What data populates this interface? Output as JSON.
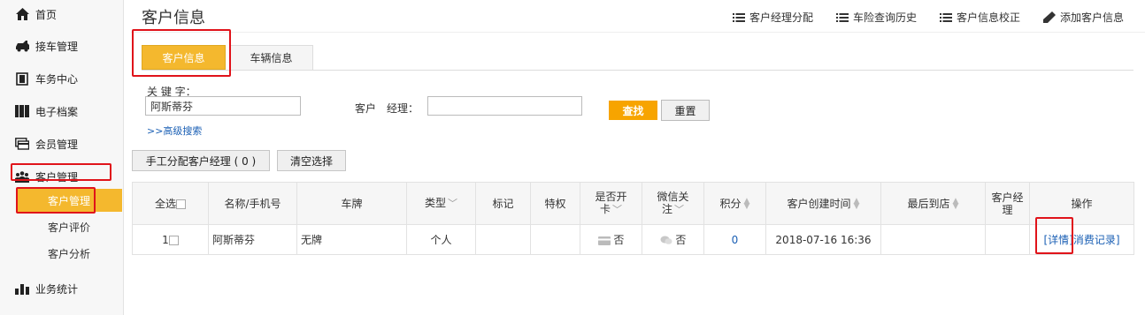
{
  "sidebar": {
    "items": [
      {
        "label": "首页",
        "icon": "home-icon"
      },
      {
        "label": "接车管理",
        "icon": "car-icon"
      },
      {
        "label": "车务中心",
        "icon": "door-icon"
      },
      {
        "label": "电子档案",
        "icon": "archive-icon"
      },
      {
        "label": "会员管理",
        "icon": "card-icon"
      },
      {
        "label": "客户管理",
        "icon": "people-icon"
      },
      {
        "label": "业务统计",
        "icon": "chart-icon"
      }
    ],
    "sub_items": [
      {
        "label": "客户管理",
        "active": true
      },
      {
        "label": "客户评价",
        "active": false
      },
      {
        "label": "客户分析",
        "active": false
      }
    ]
  },
  "header": {
    "title": "客户信息",
    "toolbar": [
      {
        "label": "客户经理分配",
        "icon": "list-icon"
      },
      {
        "label": "车险查询历史",
        "icon": "list-icon"
      },
      {
        "label": "客户信息校正",
        "icon": "list-icon"
      },
      {
        "label": "添加客户信息",
        "icon": "pencil-icon"
      }
    ]
  },
  "tabs": [
    {
      "label": "客户信息",
      "active": true
    },
    {
      "label": "车辆信息",
      "active": false
    }
  ],
  "search": {
    "keyword_label": "关 键 字：",
    "keyword_value": "阿斯蒂芬",
    "manager_label": "客户　经理：",
    "manager_value": "",
    "search_button": "查找",
    "reset_button": "重置",
    "advanced_link": ">>高级搜索"
  },
  "actions": {
    "assign_button": "手工分配客户经理 ( 0 )",
    "clear_button": "清空选择"
  },
  "table": {
    "headers": {
      "select_all": "全选",
      "name_phone": "名称/手机号",
      "plate": "车牌",
      "type": "类型",
      "mark": "标记",
      "privilege": "特权",
      "card_line1": "是否开",
      "card_line2": "卡",
      "wechat_line1": "微信关",
      "wechat_line2": "注",
      "points": "积分",
      "created": "客户创建时间",
      "last_visit": "最后到店",
      "manager_line1": "客户经",
      "manager_line2": "理",
      "ops": "操作"
    },
    "rows": [
      {
        "index": "1",
        "name": "阿斯蒂芬",
        "plate": "无牌",
        "type": "个人",
        "mark": "",
        "privilege": "",
        "card": "否",
        "wechat": "否",
        "points": "0",
        "created": "2018-07-16 16:36",
        "last_visit": "",
        "manager": "",
        "detail_link": "[详情]",
        "consume_link": "消费记录]"
      }
    ]
  },
  "colors": {
    "accent": "#f4b82e",
    "search_button": "#f7a400",
    "highlight_box": "#e0131a",
    "link": "#1a5fb4"
  }
}
